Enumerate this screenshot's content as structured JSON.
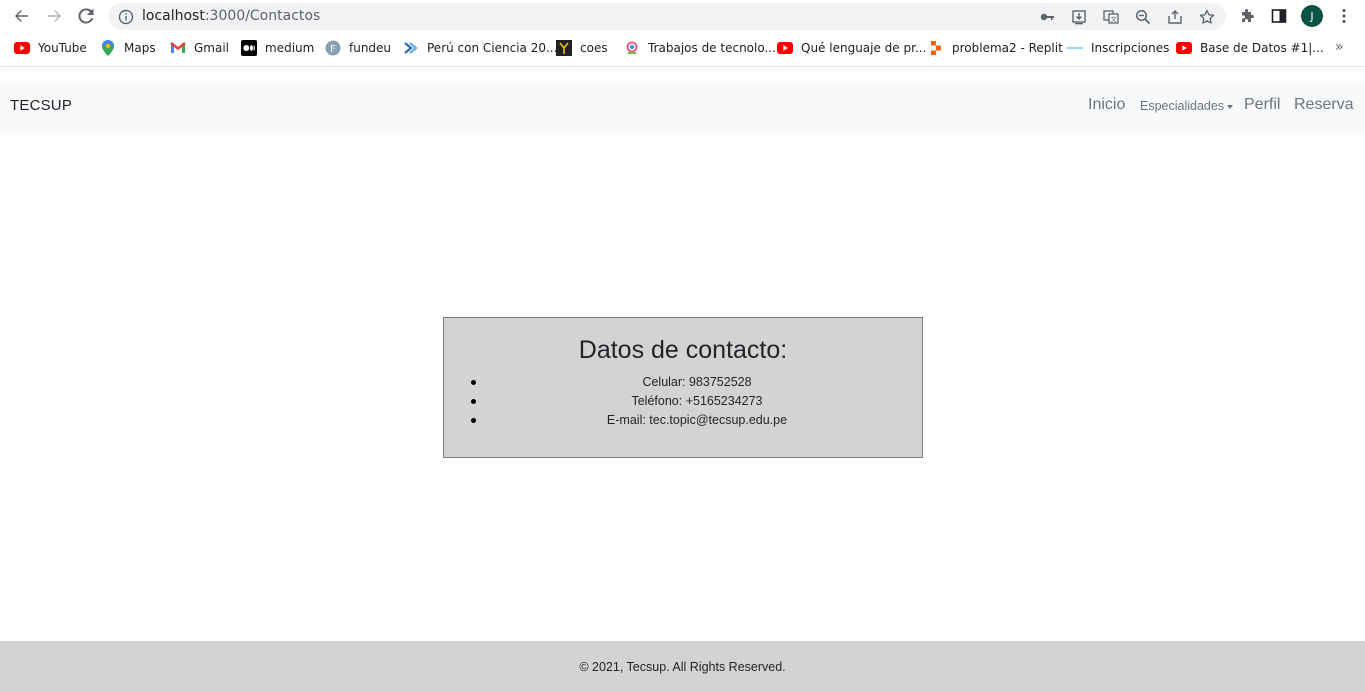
{
  "browser": {
    "url_host": "localhost",
    "url_path": ":3000/Contactos",
    "profile_initial": "J",
    "bookmarks": [
      {
        "label": "YouTube",
        "icon": "youtube-icon"
      },
      {
        "label": "Maps",
        "icon": "maps-icon"
      },
      {
        "label": "Gmail",
        "icon": "gmail-icon"
      },
      {
        "label": "medium",
        "icon": "medium-icon"
      },
      {
        "label": "fundeu",
        "icon": "fundeu-icon"
      },
      {
        "label": "Perú con Ciencia 20...",
        "icon": "arrow-icon"
      },
      {
        "label": "coes",
        "icon": "coes-icon"
      },
      {
        "label": "Trabajos de tecnolo...",
        "icon": "search-jobs-icon"
      },
      {
        "label": "Qué lenguaje de pr...",
        "icon": "youtube-icon"
      },
      {
        "label": "problema2 - Replit",
        "icon": "replit-icon"
      },
      {
        "label": "Inscripciones",
        "icon": "dash-icon"
      },
      {
        "label": "Base de Datos #1|...",
        "icon": "youtube-icon"
      }
    ],
    "more_label": "»"
  },
  "navbar": {
    "brand": "TECSUP",
    "links": {
      "inicio": "Inicio",
      "especialidades": "Especialidades",
      "perfil": "Perfil",
      "reserva": "Reserva"
    }
  },
  "contact": {
    "title": "Datos de contacto:",
    "items": [
      "Celular: 983752528",
      "Teléfono: +5165234273",
      "E-mail: tec.topic@tecsup.edu.pe"
    ]
  },
  "footer": {
    "text": "© 2021, Tecsup. All Rights Reserved."
  },
  "colors": {
    "card_bg": "#d3d3d3",
    "footer_bg": "#d3d3d3",
    "navbar_bg": "#f8f9fa"
  }
}
